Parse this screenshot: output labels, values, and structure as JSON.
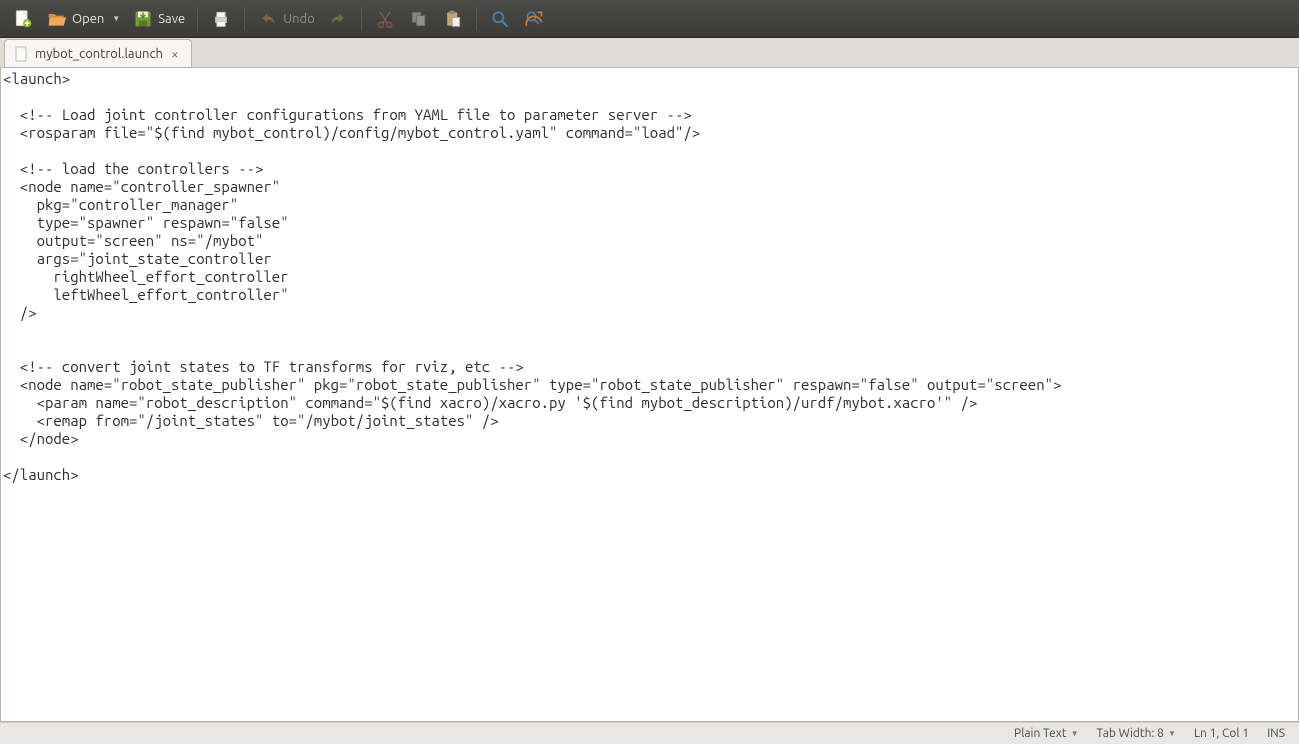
{
  "toolbar": {
    "new_tooltip": "New",
    "open_label": "Open",
    "save_label": "Save",
    "print_tooltip": "Print",
    "undo_label": "Undo",
    "redo_tooltip": "Redo",
    "cut_tooltip": "Cut",
    "copy_tooltip": "Copy",
    "paste_tooltip": "Paste",
    "find_tooltip": "Find",
    "replace_tooltip": "Find and Replace"
  },
  "tab": {
    "filename": "mybot_control.launch",
    "close": "×"
  },
  "editor": {
    "content": "<launch>\n\n  <!-- Load joint controller configurations from YAML file to parameter server -->\n  <rosparam file=\"$(find mybot_control)/config/mybot_control.yaml\" command=\"load\"/>\n\n  <!-- load the controllers -->\n  <node name=\"controller_spawner\"\n    pkg=\"controller_manager\"\n    type=\"spawner\" respawn=\"false\"\n    output=\"screen\" ns=\"/mybot\"\n    args=\"joint_state_controller\n      rightWheel_effort_controller\n      leftWheel_effort_controller\"\n  />\n\n\n  <!-- convert joint states to TF transforms for rviz, etc -->\n  <node name=\"robot_state_publisher\" pkg=\"robot_state_publisher\" type=\"robot_state_publisher\" respawn=\"false\" output=\"screen\">\n    <param name=\"robot_description\" command=\"$(find xacro)/xacro.py '$(find mybot_description)/urdf/mybot.xacro'\" />\n    <remap from=\"/joint_states\" to=\"/mybot/joint_states\" />\n  </node>\n\n</launch>"
  },
  "statusbar": {
    "syntax": "Plain Text",
    "tabwidth": "Tab Width: 8",
    "position": "Ln 1, Col 1",
    "insert_mode": "INS"
  }
}
